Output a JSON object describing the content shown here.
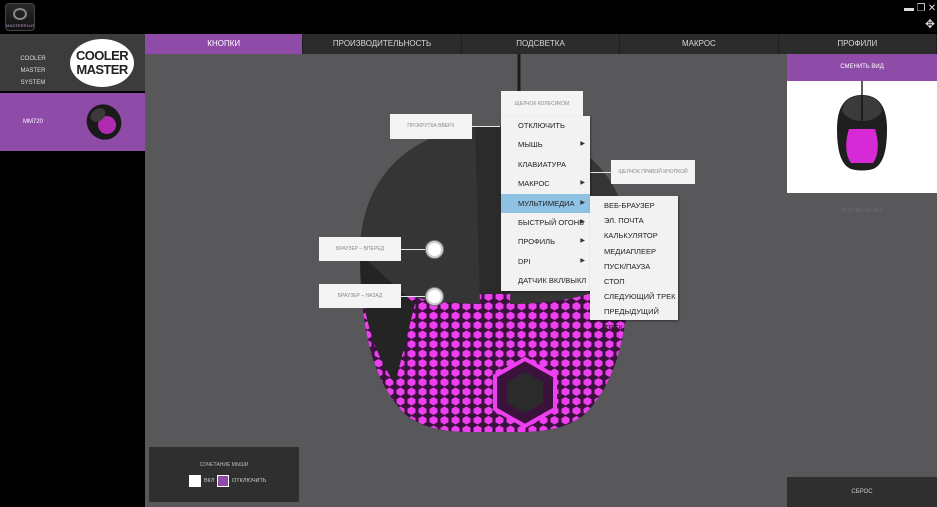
{
  "app": {
    "logo_label": "MASTERPLUS+"
  },
  "sidebar": {
    "brand_name": "COOLER MASTER SYSTEM",
    "logo_line1": "COOLER",
    "logo_line2": "MASTER",
    "device_name": "MM720"
  },
  "tabs": [
    {
      "label": "КНОПКИ",
      "active": true
    },
    {
      "label": "ПРОИЗВОДИТЕЛЬНОСТЬ",
      "active": false
    },
    {
      "label": "ПОДСВЕТКА",
      "active": false
    },
    {
      "label": "МАКРОС",
      "active": false
    },
    {
      "label": "ПРОФИЛИ",
      "active": false
    }
  ],
  "callouts": {
    "scroll_click": "ЩЕЛЧОК КОЛЕСИКОМ",
    "scroll_up": "ПРОКРУТКА ВВЕРХ",
    "right_click": "ЩЕЛЧОК ПРАВОЙ КНОПКОЙ",
    "forward": "БРАУЗЕР – ВПЕРЕД",
    "back": "БРАУЗЕР – НАЗАД"
  },
  "menu": {
    "items": [
      {
        "label": "ОТКЛЮЧИТЬ",
        "submenu": false
      },
      {
        "label": "МЫШЬ",
        "submenu": true
      },
      {
        "label": "КЛАВИАТУРА",
        "submenu": false
      },
      {
        "label": "МАКРОС",
        "submenu": true
      },
      {
        "label": "МУЛЬТИМЕДИА",
        "submenu": true,
        "active": true
      },
      {
        "label": "БЫСТРЫЙ ОГОНЬ",
        "submenu": true
      },
      {
        "label": "ПРОФИЛЬ",
        "submenu": true
      },
      {
        "label": "DPI",
        "submenu": true
      },
      {
        "label": "ДАТЧИК ВКЛ/ВЫКЛ",
        "submenu": false
      }
    ],
    "submenu": [
      "ВЕБ-БРАУЗЕР",
      "ЭЛ. ПОЧТА",
      "КАЛЬКУЛЯТОР",
      "МЕДИАПЛЕЕР",
      "ПУСК/ПАУЗА",
      "СТОП",
      "СЛЕДУЮЩИЙ ТРЕК",
      "ПРЕДЫДУЩИЙ ТРЕК"
    ]
  },
  "combo": {
    "title": "СОЧЕТАНИЕ МЫШИ",
    "on_label": "ВКЛ",
    "off_label": "ОТКЛЮЧИТЬ",
    "selected": "off"
  },
  "right_panel": {
    "change_view": "СМЕНИТЬ ВИД",
    "faded_label": "ПОДСВЕТКА ВКЛ",
    "reset": "СБРОС"
  },
  "colors": {
    "accent": "#8f4ba8",
    "glow": "#e22ee0",
    "menu_highlight": "#8fc1e3",
    "main_bg": "#58585b"
  },
  "icons": {
    "minimize": "minimize-icon",
    "maximize": "maximize-icon",
    "close": "close-icon",
    "resize": "resize-arrows-icon",
    "submenu_arrow": "triangle-right-icon"
  }
}
